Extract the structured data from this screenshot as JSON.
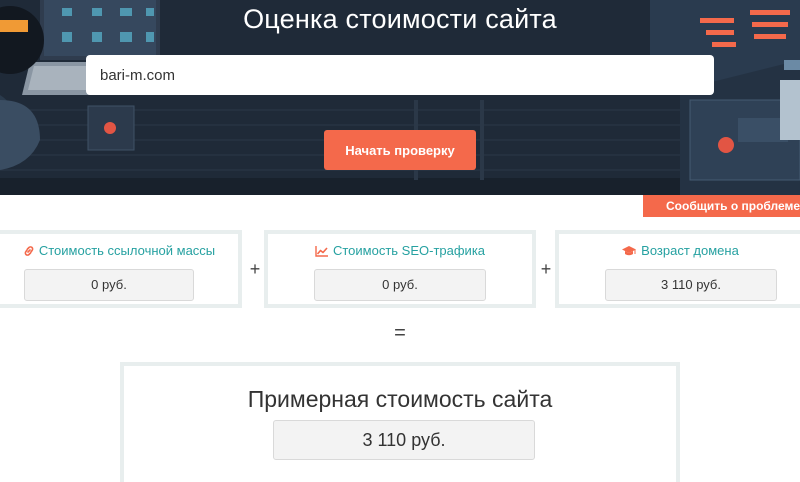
{
  "hero": {
    "title": "Оценка стоимости сайта",
    "url_value": "bari-m.com",
    "start_button": "Начать проверку"
  },
  "report_button": "Сообщить о проблеме",
  "metrics": [
    {
      "title": "Стоимость ссылочной массы",
      "icon": "link-icon",
      "value": "0 руб."
    },
    {
      "title": "Стоимость SEO-трафика",
      "icon": "chart-line-icon",
      "value": "0 руб."
    },
    {
      "title": "Возраст домена",
      "icon": "graduation-cap-icon",
      "value": "3 110 руб."
    }
  ],
  "operators": {
    "plus": "+",
    "equals": "="
  },
  "total": {
    "title": "Примерная стоимость сайта",
    "value": "3 110 руб."
  },
  "colors": {
    "accent": "#f4694b",
    "teal": "#26a1a1",
    "hero_bg": "#1f2a38",
    "card_border": "#e8eeee"
  }
}
